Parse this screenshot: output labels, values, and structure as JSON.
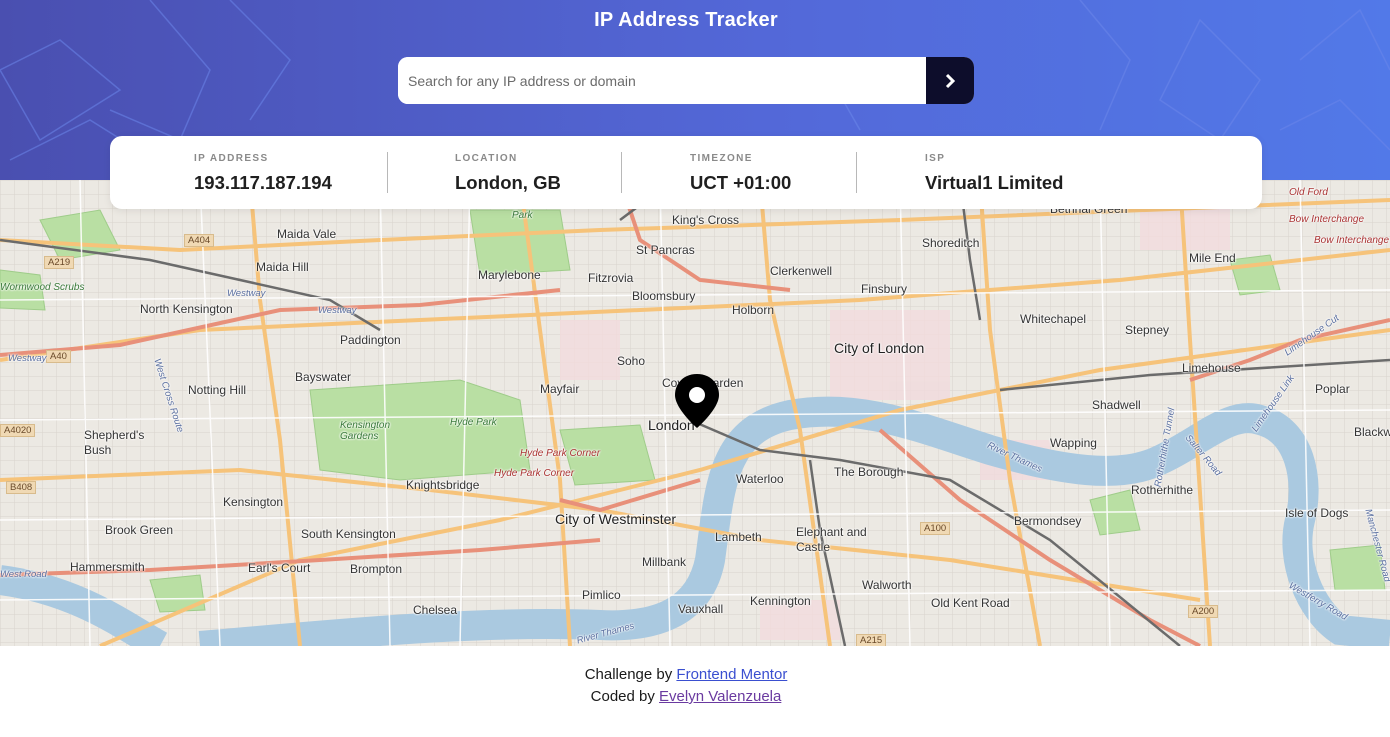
{
  "header": {
    "title": "IP Address Tracker",
    "search": {
      "placeholder": "Search for any IP address or domain",
      "value": ""
    },
    "submit_icon": "chevron-right-icon"
  },
  "info": [
    {
      "label": "IP ADDRESS",
      "value": "193.117.187.194"
    },
    {
      "label": "LOCATION",
      "value": "London, GB"
    },
    {
      "label": "TIMEZONE",
      "value": "UCT +01:00"
    },
    {
      "label": "ISP",
      "value": "Virtual1 Limited"
    }
  ],
  "map": {
    "marker_icon": "location-pin-icon",
    "places": {
      "p0": "Maida Vale",
      "p1": "Maida Hill",
      "p2": "A404",
      "p3": "A219",
      "p4": "Park",
      "p5": "King's Cross",
      "p6": "St Pancras",
      "p7": "Bethnal Green",
      "p8": "Old Ford",
      "p9": "Bow Interchange",
      "p10": "Bow Interchange",
      "p11": "Shoreditch",
      "p12": "Marylebone",
      "p13": "Fitzrovia",
      "p14": "Clerkenwell",
      "p15": "Mile End",
      "p16": "Wormwood Scrubs",
      "p17": "Westway",
      "p18": "North Kensington",
      "p19": "Westway",
      "p20": "Bloomsbury",
      "p21": "Finsbury",
      "p22": "Holborn",
      "p23": "Whitechapel",
      "p24": "Stepney",
      "p25": "A40",
      "p26": "Westway",
      "p27": "Paddington",
      "p28": "City of London",
      "p29": "Soho",
      "p30": "Limehouse",
      "p31": "Notting Hill",
      "p32": "Bayswater",
      "p33": "Mayfair",
      "p34": "Covent Garden",
      "p35": "Poplar",
      "p36": "Kensington Gardens",
      "p37": "Hyde Park",
      "p38": "London",
      "p39": "Shadwell",
      "p40": "Blackwall",
      "p41": "Shepherd's Bush",
      "p42": "Wapping",
      "p43": "Hyde Park Corner",
      "p44": "Hyde Park Corner",
      "p45": "The Borough",
      "p46": "Rotherhithe",
      "p47": "Knightsbridge",
      "p48": "Waterloo",
      "p49": "B408",
      "p50": "Kensington",
      "p51": "Bermondsey",
      "p52": "City of Westminster",
      "p53": "Isle of Dogs",
      "p54": "Brook Green",
      "p55": "South Kensington",
      "p56": "Elephant and Castle",
      "p57": "A100",
      "p58": "Lambeth",
      "p59": "Hammersmith",
      "p60": "Earl's Court",
      "p61": "Brompton",
      "p62": "Millbank",
      "p63": "Walworth",
      "p64": "Pimlico",
      "p65": "Kennington",
      "p66": "Old Kent Road",
      "p67": "Chelsea",
      "p68": "Vauxhall",
      "p69": "A200",
      "p70": "A215",
      "p71": "West Road",
      "p72": "A4020",
      "p73": "West Cross Route",
      "p74": "River Thames",
      "p75": "Limehouse Link",
      "p76": "Rotherhithe Tunnel",
      "p77": "Salter Road",
      "p78": "Manchester Road",
      "p79": "Westferry Road",
      "p80": "River Thames",
      "p81": "Limehouse Cut"
    }
  },
  "footer": {
    "challenge_prefix": "Challenge by",
    "challenge_link": "Frontend Mentor",
    "coded_prefix": "Coded by",
    "coded_link": "Evelyn Valenzuela"
  }
}
